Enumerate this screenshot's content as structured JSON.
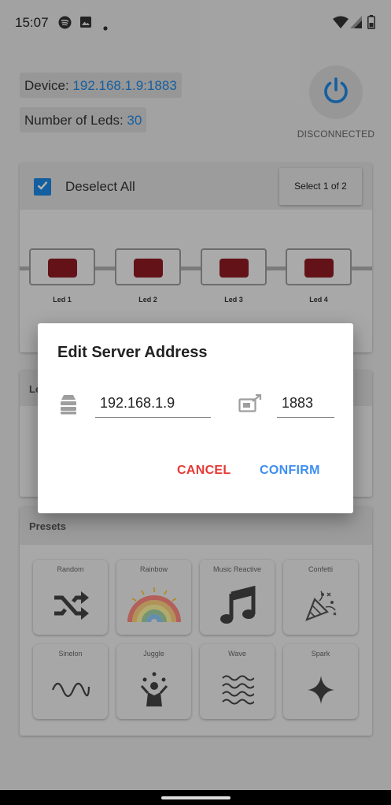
{
  "status_bar": {
    "time": "15:07",
    "icons_left": [
      "spotify-icon",
      "image-icon",
      "dot-icon"
    ],
    "icons_right": [
      "wifi-icon",
      "cell-signal-icon",
      "battery-icon"
    ]
  },
  "device": {
    "label": "Device: ",
    "address": "192.168.1.9:1883",
    "leds_label": "Number of Leds: ",
    "leds_count": "30",
    "connection_status": "DISCONNECTED"
  },
  "leds": {
    "deselect_label": "Deselect All",
    "select_button": "Select 1 of 2",
    "items": [
      {
        "name": "Led 1",
        "color": "#8f1c23"
      },
      {
        "name": "Led 2",
        "color": "#8f1c23"
      },
      {
        "name": "Led 3",
        "color": "#8f1c23"
      },
      {
        "name": "Led 4",
        "color": "#8f1c23"
      }
    ]
  },
  "hidden_card": {
    "label_fragment": "Le"
  },
  "presets": {
    "title": "Presets",
    "items": [
      {
        "label": "Random",
        "icon": "shuffle-icon"
      },
      {
        "label": "Rainbow",
        "icon": "rainbow-icon"
      },
      {
        "label": "Music Reactive",
        "icon": "music-note-icon"
      },
      {
        "label": "Confetti",
        "icon": "confetti-icon"
      },
      {
        "label": "Sinelon",
        "icon": "sine-wave-icon"
      },
      {
        "label": "Juggle",
        "icon": "juggle-icon"
      },
      {
        "label": "Wave",
        "icon": "waves-icon"
      },
      {
        "label": "Spark",
        "icon": "sparkle-icon"
      }
    ]
  },
  "dialog": {
    "title": "Edit Server Address",
    "ip_value": "192.168.1.9",
    "port_value": "1883",
    "cancel_label": "CANCEL",
    "confirm_label": "CONFIRM"
  },
  "colors": {
    "accent": "#1e88e5",
    "cancel": "#e53935",
    "confirm": "#3d8ef0",
    "led_red": "#8f1c23"
  }
}
